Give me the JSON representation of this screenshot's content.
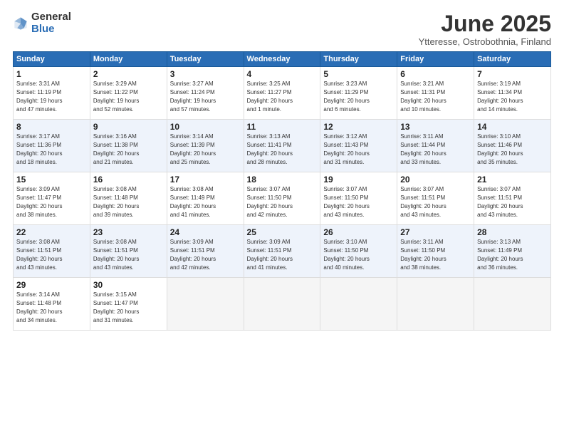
{
  "logo": {
    "general": "General",
    "blue": "Blue"
  },
  "title": "June 2025",
  "subtitle": "Ytteresse, Ostrobothnia, Finland",
  "headers": [
    "Sunday",
    "Monday",
    "Tuesday",
    "Wednesday",
    "Thursday",
    "Friday",
    "Saturday"
  ],
  "weeks": [
    [
      {
        "day": "1",
        "info": "Sunrise: 3:31 AM\nSunset: 11:19 PM\nDaylight: 19 hours\nand 47 minutes."
      },
      {
        "day": "2",
        "info": "Sunrise: 3:29 AM\nSunset: 11:22 PM\nDaylight: 19 hours\nand 52 minutes."
      },
      {
        "day": "3",
        "info": "Sunrise: 3:27 AM\nSunset: 11:24 PM\nDaylight: 19 hours\nand 57 minutes."
      },
      {
        "day": "4",
        "info": "Sunrise: 3:25 AM\nSunset: 11:27 PM\nDaylight: 20 hours\nand 1 minute."
      },
      {
        "day": "5",
        "info": "Sunrise: 3:23 AM\nSunset: 11:29 PM\nDaylight: 20 hours\nand 6 minutes."
      },
      {
        "day": "6",
        "info": "Sunrise: 3:21 AM\nSunset: 11:31 PM\nDaylight: 20 hours\nand 10 minutes."
      },
      {
        "day": "7",
        "info": "Sunrise: 3:19 AM\nSunset: 11:34 PM\nDaylight: 20 hours\nand 14 minutes."
      }
    ],
    [
      {
        "day": "8",
        "info": "Sunrise: 3:17 AM\nSunset: 11:36 PM\nDaylight: 20 hours\nand 18 minutes."
      },
      {
        "day": "9",
        "info": "Sunrise: 3:16 AM\nSunset: 11:38 PM\nDaylight: 20 hours\nand 21 minutes."
      },
      {
        "day": "10",
        "info": "Sunrise: 3:14 AM\nSunset: 11:39 PM\nDaylight: 20 hours\nand 25 minutes."
      },
      {
        "day": "11",
        "info": "Sunrise: 3:13 AM\nSunset: 11:41 PM\nDaylight: 20 hours\nand 28 minutes."
      },
      {
        "day": "12",
        "info": "Sunrise: 3:12 AM\nSunset: 11:43 PM\nDaylight: 20 hours\nand 31 minutes."
      },
      {
        "day": "13",
        "info": "Sunrise: 3:11 AM\nSunset: 11:44 PM\nDaylight: 20 hours\nand 33 minutes."
      },
      {
        "day": "14",
        "info": "Sunrise: 3:10 AM\nSunset: 11:46 PM\nDaylight: 20 hours\nand 35 minutes."
      }
    ],
    [
      {
        "day": "15",
        "info": "Sunrise: 3:09 AM\nSunset: 11:47 PM\nDaylight: 20 hours\nand 38 minutes."
      },
      {
        "day": "16",
        "info": "Sunrise: 3:08 AM\nSunset: 11:48 PM\nDaylight: 20 hours\nand 39 minutes."
      },
      {
        "day": "17",
        "info": "Sunrise: 3:08 AM\nSunset: 11:49 PM\nDaylight: 20 hours\nand 41 minutes."
      },
      {
        "day": "18",
        "info": "Sunrise: 3:07 AM\nSunset: 11:50 PM\nDaylight: 20 hours\nand 42 minutes."
      },
      {
        "day": "19",
        "info": "Sunrise: 3:07 AM\nSunset: 11:50 PM\nDaylight: 20 hours\nand 43 minutes."
      },
      {
        "day": "20",
        "info": "Sunrise: 3:07 AM\nSunset: 11:51 PM\nDaylight: 20 hours\nand 43 minutes."
      },
      {
        "day": "21",
        "info": "Sunrise: 3:07 AM\nSunset: 11:51 PM\nDaylight: 20 hours\nand 43 minutes."
      }
    ],
    [
      {
        "day": "22",
        "info": "Sunrise: 3:08 AM\nSunset: 11:51 PM\nDaylight: 20 hours\nand 43 minutes."
      },
      {
        "day": "23",
        "info": "Sunrise: 3:08 AM\nSunset: 11:51 PM\nDaylight: 20 hours\nand 43 minutes."
      },
      {
        "day": "24",
        "info": "Sunrise: 3:09 AM\nSunset: 11:51 PM\nDaylight: 20 hours\nand 42 minutes."
      },
      {
        "day": "25",
        "info": "Sunrise: 3:09 AM\nSunset: 11:51 PM\nDaylight: 20 hours\nand 41 minutes."
      },
      {
        "day": "26",
        "info": "Sunrise: 3:10 AM\nSunset: 11:50 PM\nDaylight: 20 hours\nand 40 minutes."
      },
      {
        "day": "27",
        "info": "Sunrise: 3:11 AM\nSunset: 11:50 PM\nDaylight: 20 hours\nand 38 minutes."
      },
      {
        "day": "28",
        "info": "Sunrise: 3:13 AM\nSunset: 11:49 PM\nDaylight: 20 hours\nand 36 minutes."
      }
    ],
    [
      {
        "day": "29",
        "info": "Sunrise: 3:14 AM\nSunset: 11:48 PM\nDaylight: 20 hours\nand 34 minutes."
      },
      {
        "day": "30",
        "info": "Sunrise: 3:15 AM\nSunset: 11:47 PM\nDaylight: 20 hours\nand 31 minutes."
      },
      null,
      null,
      null,
      null,
      null
    ]
  ]
}
